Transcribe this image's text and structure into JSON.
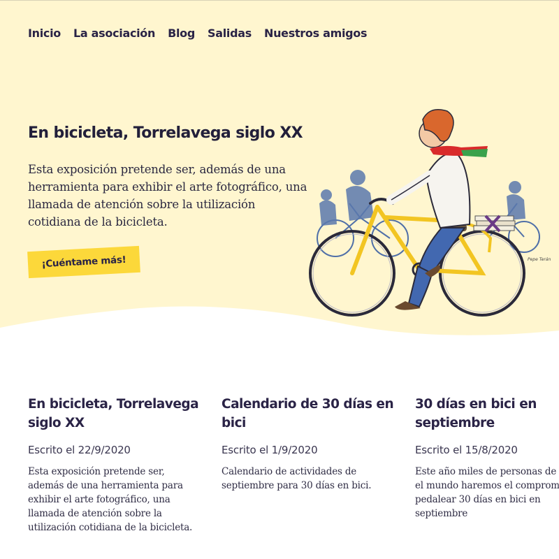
{
  "nav": {
    "items": [
      "Inicio",
      "La asociación",
      "Blog",
      "Salidas",
      "Nuestros amigos"
    ]
  },
  "hero": {
    "title": "En bicicleta, Torrelavega siglo XX",
    "text": "Esta exposición pretende ser, además de una herramienta para exhibir el arte fotográfico, una llamada de atención sobre la utilización cotidiana de la bicicleta.",
    "cta_label": "¡Cuéntame más!",
    "illustration_signature": "Pepe Terán"
  },
  "posts": [
    {
      "title": "En bicicleta, Torrelavega siglo XX",
      "date": "Escrito el 22/9/2020",
      "excerpt": "Esta exposición pretende ser, además de una herramienta para exhibir el arte fotográfico, una llamada de atención sobre la utilización cotidiana de la bicicleta."
    },
    {
      "title": "Calendario de 30 días en bici",
      "date": "Escrito el 1/9/2020",
      "excerpt": "Calendario de actividades de septiembre para 30 días en bici."
    },
    {
      "title": "30 días en bici en septiembre",
      "date": "Escrito el 15/8/2020",
      "excerpt": "Este año miles de personas de todo el mundo haremos el compromiso de pedalear 30 días en bici en septiembre"
    }
  ],
  "colors": {
    "hero_background": "#fff6cf",
    "cta_background": "#fcd83a",
    "text_dark": "#221f3a",
    "bike_yellow": "#f2c522",
    "bike_blue": "#4f6fa8"
  }
}
